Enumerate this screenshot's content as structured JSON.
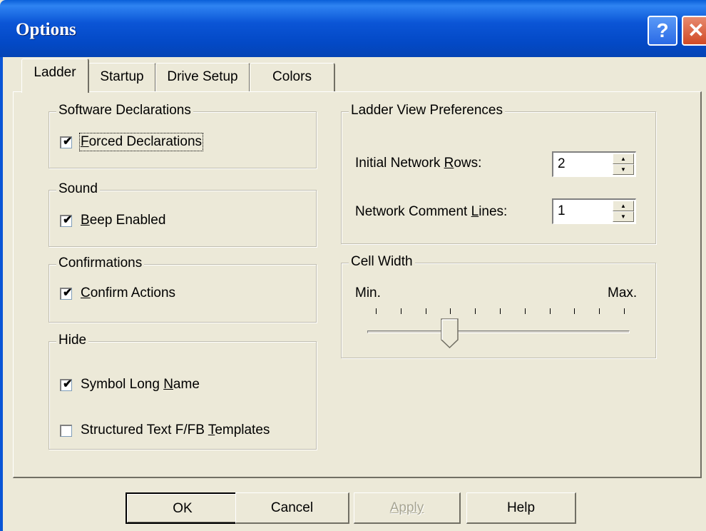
{
  "window": {
    "title": "Options",
    "help_glyph": "?",
    "close_glyph": "✕"
  },
  "tabs": [
    {
      "label": "Ladder",
      "active": true
    },
    {
      "label": "Startup",
      "active": false
    },
    {
      "label": "Drive Setup",
      "active": false
    },
    {
      "label": "Colors",
      "active": false
    }
  ],
  "software_declarations": {
    "title": "Software Declarations",
    "forced_declarations": {
      "prefix": "",
      "accel": "F",
      "suffix": "orced Declarations",
      "checked": true
    }
  },
  "sound": {
    "title": "Sound",
    "beep_enabled": {
      "prefix": "",
      "accel": "B",
      "suffix": "eep Enabled",
      "checked": true
    }
  },
  "confirmations": {
    "title": "Confirmations",
    "confirm_actions": {
      "prefix": "",
      "accel": "C",
      "suffix": "onfirm Actions",
      "checked": true
    }
  },
  "hide": {
    "title": "Hide",
    "symbol_long_name": {
      "prefix": "Symbol Long ",
      "accel": "N",
      "suffix": "ame",
      "checked": true
    },
    "structured_text": {
      "prefix": "Structured Text F/FB ",
      "accel": "T",
      "suffix": "emplates",
      "checked": false
    }
  },
  "ladder_view": {
    "title": "Ladder View Preferences",
    "initial_rows": {
      "prefix": "Initial Network ",
      "accel": "R",
      "suffix": "ows:",
      "value": "2"
    },
    "comment_lines": {
      "prefix": "Network Comment ",
      "accel": "L",
      "suffix": "ines:",
      "value": "1"
    }
  },
  "cell_width": {
    "title": "Cell Width",
    "min_label": "Min.",
    "max_label": "Max.",
    "tick_count": 11,
    "position": 3
  },
  "buttons": {
    "ok": "OK",
    "cancel": "Cancel",
    "apply": "Apply",
    "help": "Help"
  }
}
